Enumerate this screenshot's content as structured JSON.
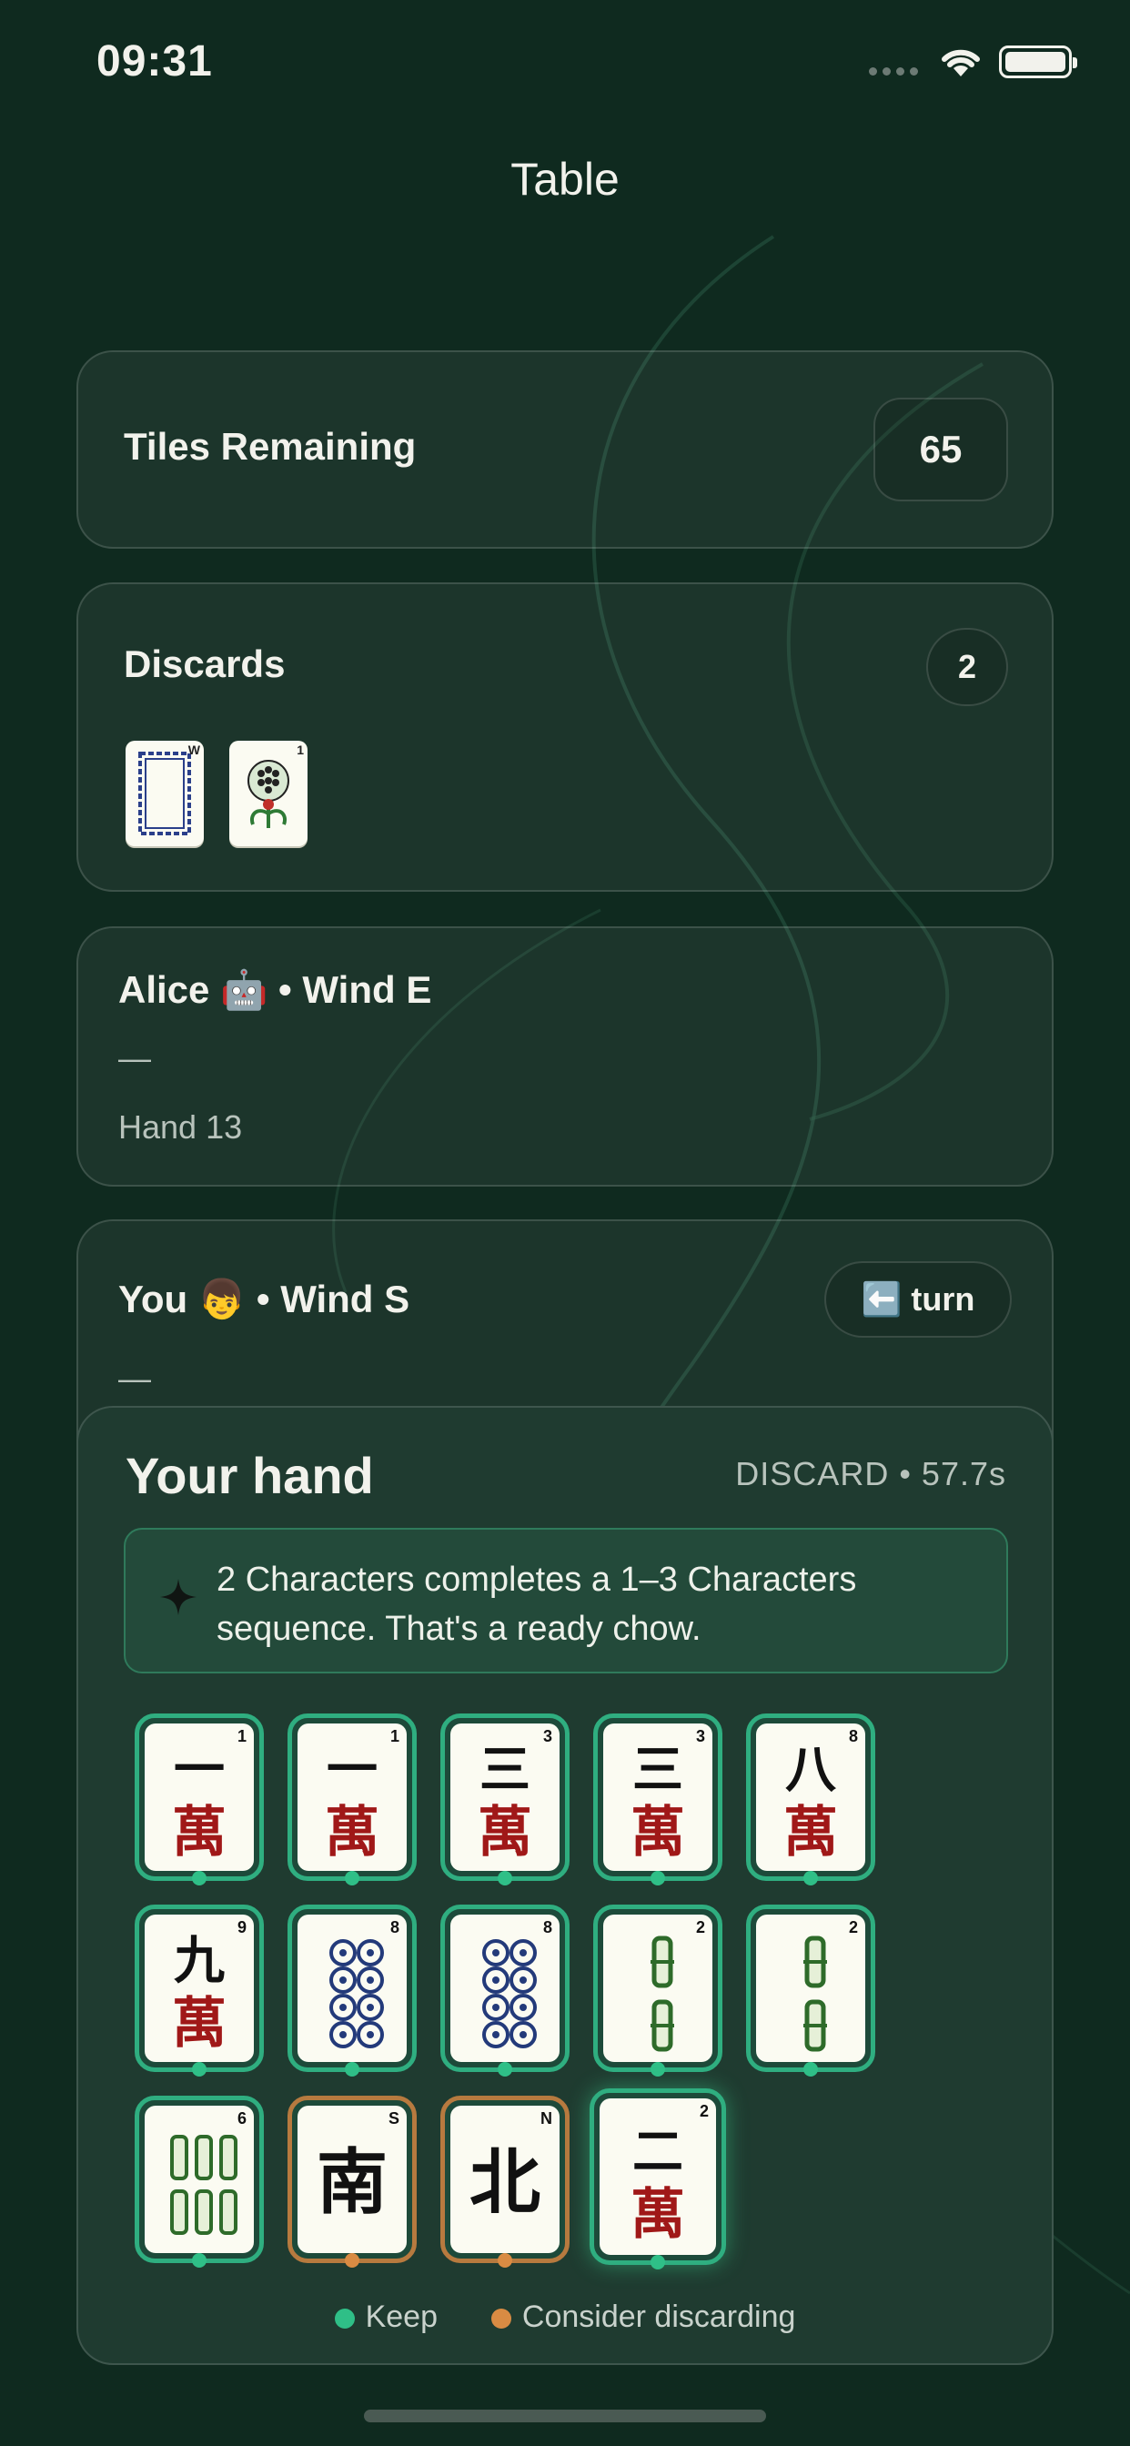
{
  "status_bar": {
    "time": "09:31"
  },
  "header": {
    "title": "Table"
  },
  "tiles_remaining": {
    "label": "Tiles Remaining",
    "count": "65"
  },
  "discards": {
    "label": "Discards",
    "count": "2",
    "tiles": [
      {
        "kind": "white-dragon",
        "index": "W"
      },
      {
        "kind": "one-of-circles",
        "index": "1"
      }
    ]
  },
  "players": [
    {
      "name_line": "Alice 🤖 • Wind E",
      "status": "—",
      "hand": "Hand 13"
    },
    {
      "name_line": "You 👦 • Wind S",
      "status": "—",
      "turn_badge": "⬅️ turn"
    }
  ],
  "hand": {
    "title": "Your hand",
    "phase": "DISCARD • 57.7s",
    "hint": "2 Characters completes a 1–3 Characters sequence. That's a ready chow.",
    "tiles": [
      {
        "suit": "characters",
        "number": "1",
        "top": "一",
        "bottom": "萬",
        "advice": "keep"
      },
      {
        "suit": "characters",
        "number": "1",
        "top": "一",
        "bottom": "萬",
        "advice": "keep"
      },
      {
        "suit": "characters",
        "number": "3",
        "top": "三",
        "bottom": "萬",
        "advice": "keep"
      },
      {
        "suit": "characters",
        "number": "3",
        "top": "三",
        "bottom": "萬",
        "advice": "keep"
      },
      {
        "suit": "characters",
        "number": "8",
        "top": "八",
        "bottom": "萬",
        "advice": "keep"
      },
      {
        "suit": "characters",
        "number": "9",
        "top": "九",
        "bottom": "萬",
        "advice": "keep"
      },
      {
        "suit": "circles",
        "number": "8",
        "advice": "keep"
      },
      {
        "suit": "circles",
        "number": "8",
        "advice": "keep"
      },
      {
        "suit": "bamboo",
        "number": "2",
        "advice": "keep"
      },
      {
        "suit": "bamboo",
        "number": "2",
        "advice": "keep"
      },
      {
        "suit": "bamboo",
        "number": "6",
        "advice": "keep"
      },
      {
        "suit": "wind",
        "number": "S",
        "glyph": "南",
        "advice": "discard"
      },
      {
        "suit": "wind",
        "number": "N",
        "glyph": "北",
        "advice": "discard"
      },
      {
        "suit": "characters",
        "number": "2",
        "top": "二",
        "bottom": "萬",
        "advice": "keep",
        "selected": true
      }
    ],
    "legend": {
      "keep": "Keep",
      "discard": "Consider discarding"
    }
  },
  "colors": {
    "background": "#0f2a1f",
    "keep": "#2fbf87",
    "discard": "#d98b43",
    "character_red": "#a01818"
  }
}
